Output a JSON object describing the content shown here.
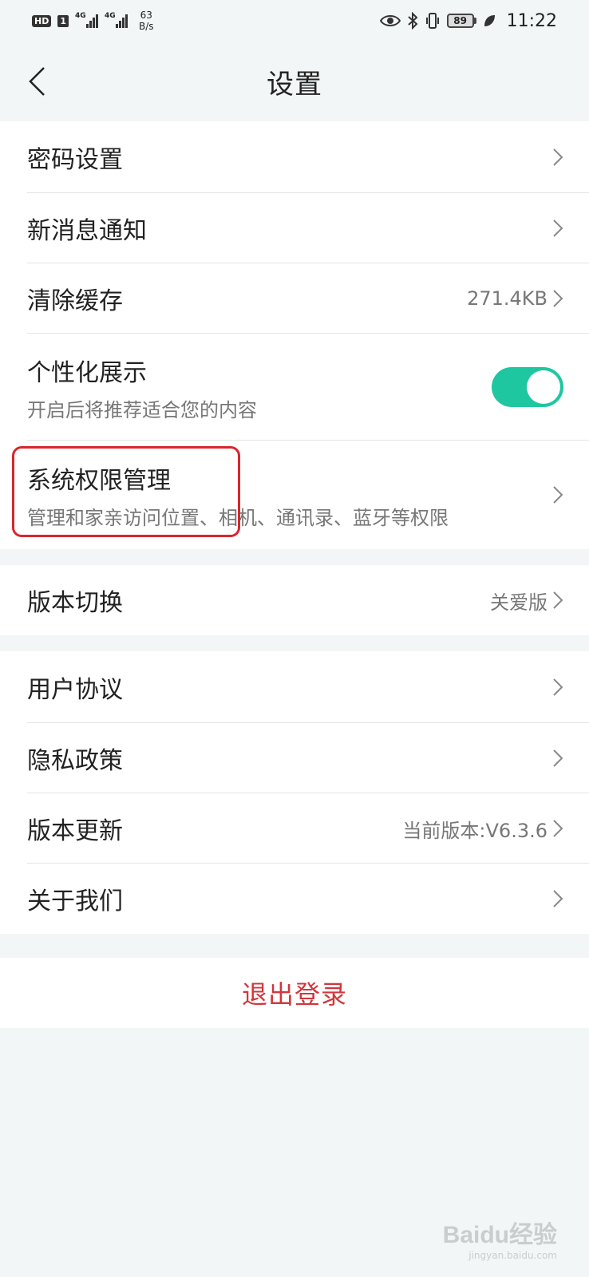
{
  "status_bar": {
    "hd": "HD",
    "sim": "1",
    "net_gen_1": "4G",
    "net_gen_2": "4G",
    "speed_value": "63",
    "speed_unit": "B/s",
    "battery": "89",
    "time": "11:22"
  },
  "header": {
    "title": "设置"
  },
  "groups": {
    "main": [
      {
        "title": "密码设置"
      },
      {
        "title": "新消息通知"
      },
      {
        "title": "清除缓存",
        "value": "271.4KB"
      },
      {
        "title": "个性化展示",
        "subtitle": "开启后将推荐适合您的内容",
        "toggle_on": true
      },
      {
        "title": "系统权限管理",
        "subtitle": "管理和家亲访问位置、相机、通讯录、蓝牙等权限"
      }
    ],
    "version": [
      {
        "title": "版本切换",
        "value": "关爱版"
      }
    ],
    "about": [
      {
        "title": "用户协议"
      },
      {
        "title": "隐私政策"
      },
      {
        "title": "版本更新",
        "value": "当前版本:V6.3.6"
      },
      {
        "title": "关于我们"
      }
    ]
  },
  "logout": {
    "label": "退出登录"
  },
  "watermark": {
    "logo": "Baidu经验",
    "url": "jingyan.baidu.com"
  },
  "colors": {
    "accent": "#1fc7a0",
    "logout": "#d2363b",
    "highlight": "#d9262c",
    "background": "#f2f6f6"
  }
}
